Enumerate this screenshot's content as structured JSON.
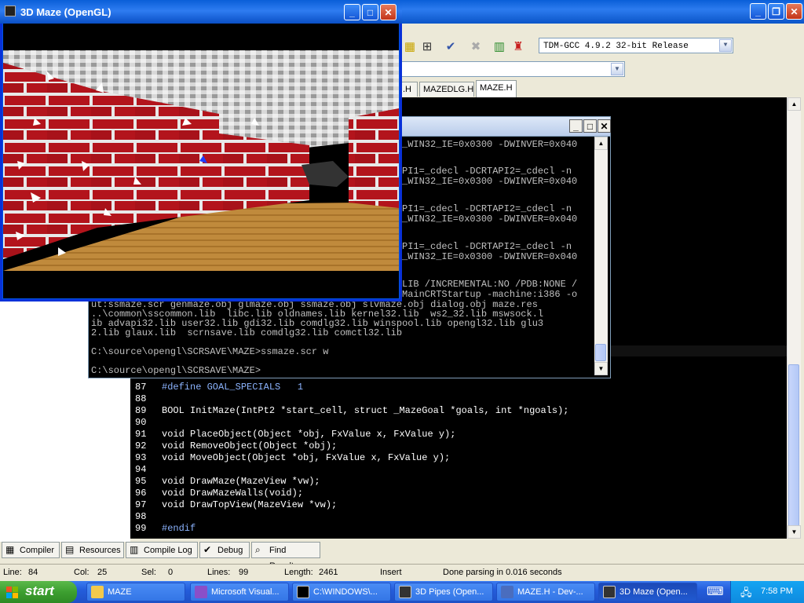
{
  "maze_window": {
    "title": "3D Maze (OpenGL)"
  },
  "ide": {
    "compiler": "TDM-GCC 4.9.2 32-bit Release",
    "tabs": [
      ".H",
      "MAZEDLG.H",
      "MAZE.H"
    ],
    "code_lines": [
      {
        "num": "87",
        "text": "#define GOAL_SPECIALS   1"
      },
      {
        "num": "88",
        "text": ""
      },
      {
        "num": "89",
        "text": "BOOL InitMaze(IntPt2 *start_cell, struct _MazeGoal *goals, int *ngoals);"
      },
      {
        "num": "90",
        "text": ""
      },
      {
        "num": "91",
        "text": "void PlaceObject(Object *obj, FxValue x, FxValue y);"
      },
      {
        "num": "92",
        "text": "void RemoveObject(Object *obj);"
      },
      {
        "num": "93",
        "text": "void MoveObject(Object *obj, FxValue x, FxValue y);"
      },
      {
        "num": "94",
        "text": ""
      },
      {
        "num": "95",
        "text": "void DrawMaze(MazeView *vw);"
      },
      {
        "num": "96",
        "text": "void DrawMazeWalls(void);"
      },
      {
        "num": "97",
        "text": "void DrawTopView(MazeView *vw);"
      },
      {
        "num": "98",
        "text": ""
      },
      {
        "num": "99",
        "text": "#endif"
      }
    ],
    "bottom_tabs": [
      "Compiler",
      "Resources",
      "Compile Log",
      "Debug",
      "Find Results"
    ],
    "status": {
      "line_label": "Line:",
      "line": "84",
      "col_label": "Col:",
      "col": "25",
      "sel_label": "Sel:",
      "sel": "0",
      "lines_label": "Lines:",
      "lines": "99",
      "length_label": "Length:",
      "length": "2461",
      "mode": "Insert",
      "message": "Done parsing in 0.016 seconds"
    }
  },
  "console": {
    "lines": [
      "_WIN32_IE=0x0300 -DWINVER=0x040",
      "",
      "PI1=_cdecl -DCRTAPI2=_cdecl -n",
      "_WIN32_IE=0x0300 -DWINVER=0x040",
      "",
      "PI1=_cdecl -DCRTAPI2=_cdecl -n",
      "_WIN32_IE=0x0300 -DWINVER=0x040",
      "",
      "PI1=_cdecl -DCRTAPI2=_cdecl -n",
      "_WIN32_IE=0x0300 -DWINVER=0x040"
    ],
    "full_lines": [
      "LIB /INCREMENTAL:NO /PDB:NONE /",
      "MainCRTStartup -machine:i386 -o",
      "ut:ssmaze.scr genmaze.obj glmaze.obj ssmaze.obj slvmaze.obj dialog.obj maze.res",
      "..\\common\\sscommon.lib  libc.lib oldnames.lib kernel32.lib  ws2_32.lib mswsock.l",
      "ib advapi32.lib user32.lib gdi32.lib comdlg32.lib winspool.lib opengl32.lib glu3",
      "2.lib glaux.lib  scrnsave.lib comdlg32.lib comctl32.lib",
      "",
      "C:\\source\\opengl\\SCRSAVE\\MAZE>ssmaze.scr w",
      "",
      "C:\\source\\opengl\\SCRSAVE\\MAZE>"
    ]
  },
  "taskbar": {
    "start_label": "start",
    "tasks": [
      "MAZE",
      "Microsoft Visual...",
      "C:\\WINDOWS\\...",
      "3D Pipes (Open...",
      "MAZE.H - Dev-...",
      "3D Maze (Open..."
    ],
    "clock": "7:58 PM"
  }
}
